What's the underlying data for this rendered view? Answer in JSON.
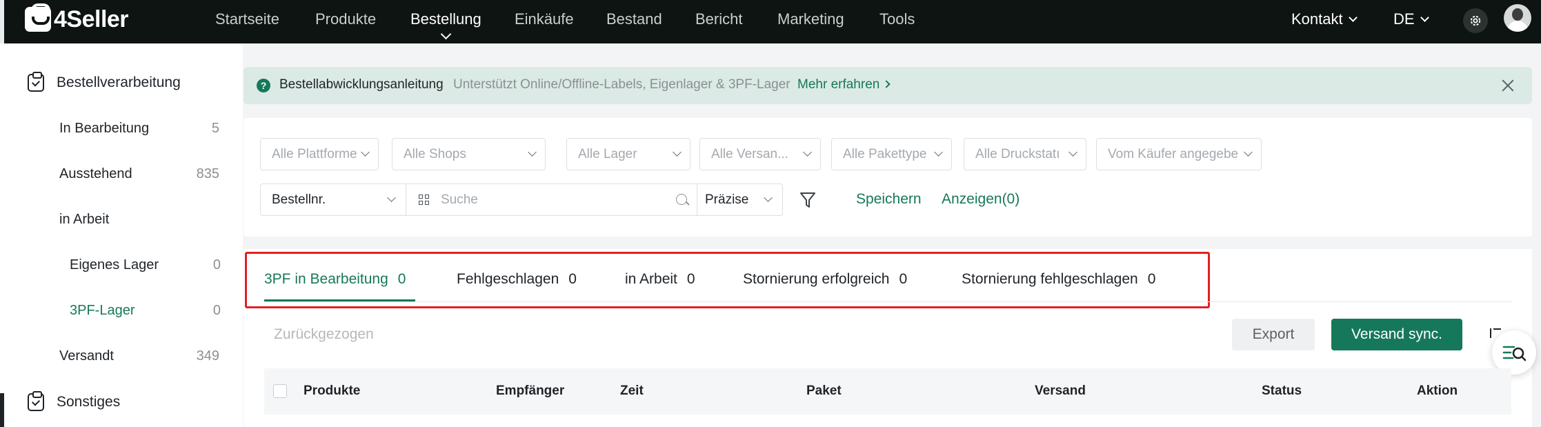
{
  "brand": {
    "name": "4Seller"
  },
  "nav": {
    "items": [
      "Startseite",
      "Produkte",
      "Bestellung",
      "Einkäufe",
      "Bestand",
      "Bericht",
      "Marketing",
      "Tools"
    ],
    "active": "Bestellung",
    "contact": "Kontakt",
    "language": "DE"
  },
  "sidebar": {
    "group_processing": "Bestellverarbeitung",
    "items": [
      {
        "label": "In Bearbeitung",
        "count": "5"
      },
      {
        "label": "Ausstehend",
        "count": "835"
      },
      {
        "label": "in Arbeit",
        "count": ""
      },
      {
        "label": "Eigenes Lager",
        "count": "0"
      },
      {
        "label": "3PF-Lager",
        "count": "0"
      },
      {
        "label": "Versandt",
        "count": "349"
      }
    ],
    "group_other": "Sonstiges"
  },
  "banner": {
    "title": "Bestellabwicklungsanleitung",
    "description": "Unterstützt Online/Offline-Labels, Eigenlager & 3PF-Lager",
    "link": "Mehr erfahren"
  },
  "filters": {
    "selects": [
      "Alle Plattforme",
      "Alle Shops",
      "Alle Lager",
      "Alle Versan...",
      "Alle Pakettype",
      "Alle Druckstatı",
      "Vom Käufer angegebe"
    ],
    "search_type": "Bestellnr.",
    "search_placeholder": "Suche",
    "search_mode": "Präzise",
    "save": "Speichern",
    "show": "Anzeigen(0)"
  },
  "tabs": [
    {
      "label": "3PF in Bearbeitung",
      "count": "0"
    },
    {
      "label": "Fehlgeschlagen",
      "count": "0"
    },
    {
      "label": "in Arbeit",
      "count": "0"
    },
    {
      "label": "Stornierung erfolgreich",
      "count": "0"
    },
    {
      "label": "Stornierung fehlgeschlagen",
      "count": "0"
    }
  ],
  "toolbar": {
    "withdrawn": "Zurückgezogen",
    "export": "Export",
    "sync": "Versand sync."
  },
  "table": {
    "headers": [
      "Produkte",
      "Empfänger",
      "Zeit",
      "Paket",
      "Versand",
      "Status",
      "Aktion"
    ]
  },
  "colors": {
    "accent": "#16785a",
    "nav_bg": "#0d1411",
    "banner_bg": "#dbeae5",
    "highlight_box": "#e02020"
  },
  "icons": [
    "logo-icon",
    "chevron-down-icon",
    "gear-icon",
    "avatar",
    "clipboard-icon",
    "help-icon",
    "close-icon",
    "scan-icon",
    "search-icon",
    "filter-icon",
    "sort-icon",
    "list-search-icon"
  ]
}
